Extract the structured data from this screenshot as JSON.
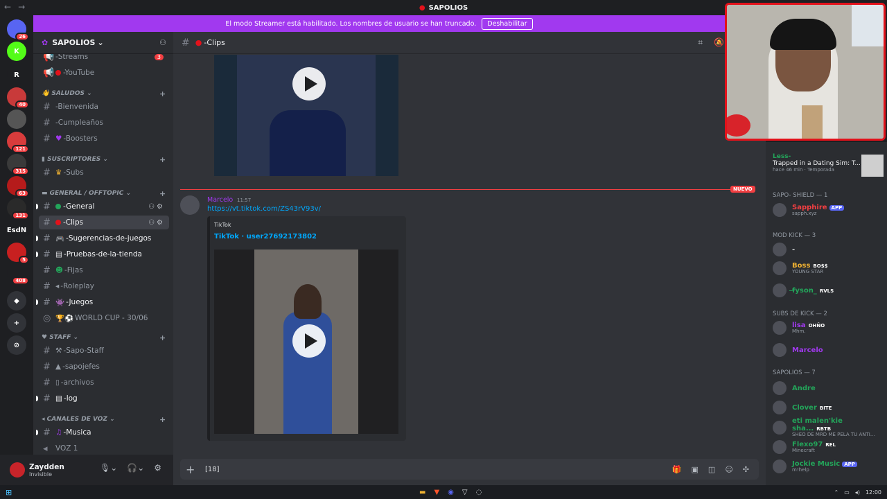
{
  "app": {
    "title": "SAPOLIOS",
    "nav_back": "←",
    "nav_fwd": "→"
  },
  "banner": {
    "text": "El modo Streamer está habilitado. Los nombres de usuario se han truncado.",
    "button": "Deshabilitar"
  },
  "servers": [
    {
      "label": "",
      "badge": "26",
      "color": "#5865f2"
    },
    {
      "label": "K",
      "badge": "",
      "color": "#53fc18"
    },
    {
      "label": "R",
      "badge": "",
      "color": "#1e1f22"
    },
    {
      "label": "",
      "badge": "40",
      "color": "#c83a3a"
    },
    {
      "label": "",
      "badge": "",
      "color": "#555"
    },
    {
      "label": "",
      "badge": "121",
      "color": "#d83c3c"
    },
    {
      "label": "",
      "badge": "315",
      "color": "#3a3a3a"
    },
    {
      "label": "",
      "badge": "63",
      "color": "#b51b1b"
    },
    {
      "label": "",
      "badge": "131",
      "color": "#2a2a2a"
    },
    {
      "label": "EsdN",
      "badge": "",
      "color": "#1e1f22"
    },
    {
      "label": "",
      "badge": "5",
      "color": "#c82020"
    },
    {
      "label": "",
      "badge": "408",
      "color": "#1e1f22"
    },
    {
      "label": "◆",
      "badge": "",
      "color": "#313338"
    },
    {
      "label": "+",
      "badge": "",
      "color": "#313338"
    },
    {
      "label": "⊘",
      "badge": "",
      "color": "#313338"
    }
  ],
  "guild": {
    "name": "SAPOLIOS"
  },
  "channels": {
    "top": [
      {
        "name": "-Streams",
        "count": "3"
      },
      {
        "name": "-YouTube",
        "count": ""
      }
    ],
    "cat_saludos": "SALUDOS",
    "saludos": [
      "-Bienvenida",
      "-Cumpleaños",
      "-Boosters"
    ],
    "cat_suscriptores": "SUSCRIPTORES",
    "suscriptores": [
      "-Subs"
    ],
    "cat_general": "GENERAL / OFFTOPIC",
    "general": [
      "-General",
      "-Clips",
      "-Sugerencias-de-juegos",
      "-Pruebas-de-la-tienda",
      "-Fijas",
      "-Roleplay",
      "-Juegos",
      "WORLD CUP - 30/06"
    ],
    "cat_staff": "STAFF",
    "staff": [
      "-Sapo-Staff",
      "-sapojefes",
      "-archivos",
      "-log"
    ],
    "cat_voz": "CANALES DE VOZ",
    "voz": [
      "-Musica",
      "VOZ 1"
    ]
  },
  "user": {
    "name": "Zaydden",
    "status": "Invisible"
  },
  "header": {
    "channel": "-Clips"
  },
  "message": {
    "author": "Marcelo",
    "time": "11:57",
    "link": "https://vt.tiktok.com/ZS43rV93v/",
    "provider": "TikTok",
    "embed_title": "TikTok · user27692173802",
    "new_label": "NUEVO"
  },
  "composer": {
    "text": "[18]"
  },
  "members": {
    "activity": {
      "user": "Less-",
      "title": "Trapped in a Dating Sim: T...",
      "meta": "hace 46 min · Temporada"
    },
    "groups": [
      {
        "title": "SAPO- SHIELD — 1"
      },
      {
        "title": "MOD KICK — 3"
      },
      {
        "title": "SUBS DE KICK — 2"
      },
      {
        "title": "SAPOLIOS — 7"
      }
    ],
    "list": [
      {
        "name": "Sapphire",
        "sub": "sapph.xyz",
        "tag": "APP",
        "color": "#f23f42"
      },
      {
        "name": "-",
        "sub": "",
        "tag": "",
        "color": "#dbdee1"
      },
      {
        "name": "Boss",
        "sub": "YOUNG STAR",
        "tag": "BO$$",
        "color": "#f0b232"
      },
      {
        "name": "f̶yson_",
        "sub": "",
        "tag": "RVLS",
        "color": "#23a55a"
      },
      {
        "name": "lisa",
        "sub": "Mhm.",
        "tag": "OHÑO",
        "color": "#a139ef"
      },
      {
        "name": "Marcelo",
        "sub": "",
        "tag": "",
        "color": "#a139ef"
      },
      {
        "name": "Andre",
        "sub": "",
        "tag": "",
        "color": "#23a55a"
      },
      {
        "name": "Clover",
        "sub": "",
        "tag": "BITE",
        "color": "#23a55a"
      },
      {
        "name": "eti malen'kie sha...",
        "sub": "SHEO DE MRD ME PELA TU ANTI...",
        "tag": "RBTB",
        "color": "#23a55a"
      },
      {
        "name": "Flexo97",
        "sub": "Minecraft",
        "tag": "REL",
        "color": "#23a55a"
      },
      {
        "name": "Jockie Music",
        "sub": "m!help",
        "tag": "APP",
        "color": "#23a55a"
      }
    ]
  },
  "taskbar": {
    "time": "12:00"
  }
}
